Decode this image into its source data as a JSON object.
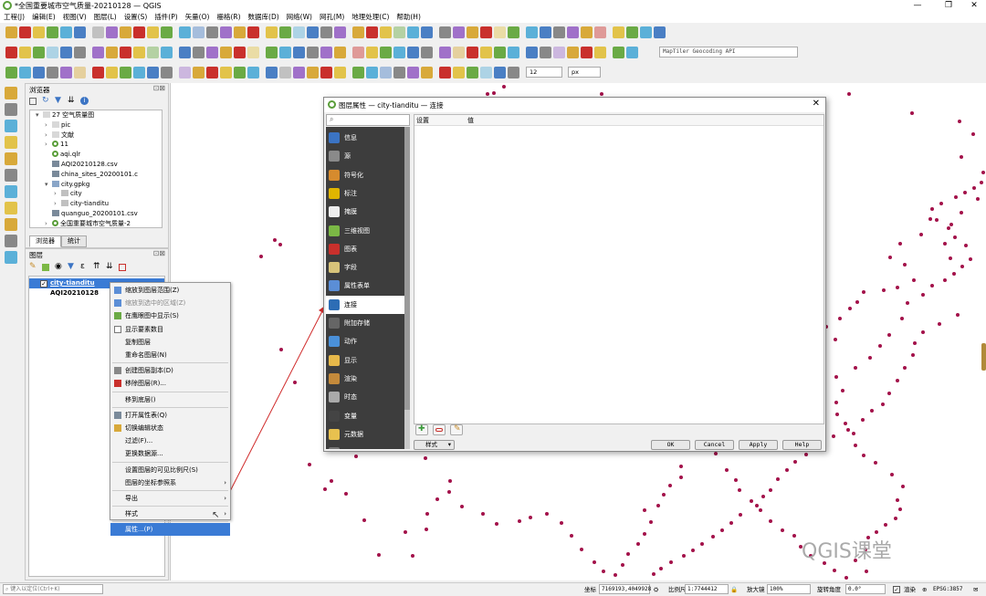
{
  "window": {
    "title": "*全国重要城市空气质量-20210128 — QGIS",
    "controls": [
      "—",
      "❐",
      "✕"
    ]
  },
  "menu": [
    "工程(J)",
    "编辑(E)",
    "视图(V)",
    "图层(L)",
    "设置(S)",
    "插件(P)",
    "矢量(O)",
    "栅格(R)",
    "数据库(D)",
    "网络(W)",
    "网孔(M)",
    "地理处理(C)",
    "帮助(H)"
  ],
  "toolbar": {
    "geocoding_input": "MapTiler Geocoding API",
    "font_size": "12",
    "font_unit": "px"
  },
  "browser": {
    "title": "浏览器",
    "tree": [
      {
        "label": "27 空气质量图",
        "arrow": "▾",
        "indent": 36,
        "icon": "folder"
      },
      {
        "label": "pic",
        "arrow": "›",
        "indent": 46,
        "icon": "folder"
      },
      {
        "label": "文献",
        "arrow": "›",
        "indent": 46,
        "icon": "folder"
      },
      {
        "label": "11",
        "arrow": "›",
        "indent": 46,
        "icon": "qgis"
      },
      {
        "label": "aqi.qlr",
        "arrow": "",
        "indent": 46,
        "icon": "qgis"
      },
      {
        "label": "AQI20210128.csv",
        "arrow": "",
        "indent": 46,
        "icon": "table"
      },
      {
        "label": "china_sites_20200101.c",
        "arrow": "",
        "indent": 46,
        "icon": "table"
      },
      {
        "label": "city.gpkg",
        "arrow": "▾",
        "indent": 46,
        "icon": "db"
      },
      {
        "label": "city",
        "arrow": "›",
        "indent": 56,
        "icon": "pts"
      },
      {
        "label": "city-tianditu",
        "arrow": "›",
        "indent": 56,
        "icon": "pts"
      },
      {
        "label": "quanguo_20200101.csv",
        "arrow": "",
        "indent": 46,
        "icon": "table"
      },
      {
        "label": "全国重要城市空气质量-2",
        "arrow": "›",
        "indent": 46,
        "icon": "qgis"
      }
    ],
    "tabs": [
      "浏览器",
      "统计"
    ]
  },
  "layers": {
    "title": "图层",
    "items": [
      {
        "label": "city-tianditu",
        "selected": true,
        "checked": true
      },
      {
        "label": "AQI20210128",
        "selected": false,
        "checked": false
      }
    ]
  },
  "context_menu": {
    "items": [
      {
        "label": "缩放到图层范围(Z)",
        "state": "normal",
        "icon": "zoom"
      },
      {
        "label": "缩放到选中的区域(Z)",
        "state": "disabled",
        "icon": "zoom"
      },
      {
        "label": "在鹰眼图中显示(S)",
        "state": "normal",
        "icon": "eye"
      },
      {
        "label": "显示要素数目",
        "state": "normal",
        "icon": "box"
      },
      {
        "label": "复制图层",
        "state": "normal",
        "icon": ""
      },
      {
        "label": "重命名图层(N)",
        "state": "normal",
        "icon": ""
      },
      {
        "label": "创建图层副本(D)",
        "state": "normal",
        "icon": "dup",
        "sep_before": true
      },
      {
        "label": "移除图层(R)...",
        "state": "normal",
        "icon": "remove"
      },
      {
        "label": "移到底层()",
        "state": "normal",
        "icon": "",
        "sep_before": true
      },
      {
        "label": "打开属性表(Q)",
        "state": "normal",
        "icon": "table",
        "sep_before": true
      },
      {
        "label": "切换编辑状态",
        "state": "normal",
        "icon": "pencil"
      },
      {
        "label": "过滤(F)...",
        "state": "normal",
        "icon": ""
      },
      {
        "label": "更换数据源...",
        "state": "normal",
        "icon": ""
      },
      {
        "label": "设置图层的可见比例尺(S)",
        "state": "normal",
        "icon": "",
        "sep_before": true
      },
      {
        "label": "图层的坐标参照系",
        "state": "normal",
        "icon": "",
        "submenu": true
      },
      {
        "label": "导出",
        "state": "normal",
        "icon": "",
        "submenu": true,
        "sep_before": true
      },
      {
        "label": "样式",
        "state": "normal",
        "icon": "",
        "submenu": true,
        "sep_before": true
      },
      {
        "label": "属性...(P)",
        "state": "highlighted",
        "icon": "",
        "sep_before": true
      }
    ]
  },
  "dialog": {
    "title": "图层属性 — city-tianditu — 连接",
    "search_placeholder": "",
    "sections": [
      {
        "label": "信息",
        "color": "#3b74c4"
      },
      {
        "label": "源",
        "color": "#8a8a8a"
      },
      {
        "label": "符号化",
        "color": "#d68b2e"
      },
      {
        "label": "标注",
        "color": "#e0b500"
      },
      {
        "label": "掩膜",
        "color": "#eeeeee"
      },
      {
        "label": "三维视图",
        "color": "#7bb845"
      },
      {
        "label": "图表",
        "color": "#c9302c"
      },
      {
        "label": "字段",
        "color": "#d7c37a"
      },
      {
        "label": "属性表单",
        "color": "#5b8ed6"
      },
      {
        "label": "连接",
        "color": "#2d6db5",
        "active": true
      },
      {
        "label": "附加存储",
        "color": "#666666"
      },
      {
        "label": "动作",
        "color": "#4a90d9"
      },
      {
        "label": "显示",
        "color": "#e6b84a"
      },
      {
        "label": "渲染",
        "color": "#c48a3b"
      },
      {
        "label": "时态",
        "color": "#aaaaaa"
      },
      {
        "label": "变量",
        "color": "#444444"
      },
      {
        "label": "元数据",
        "color": "#e8c14f"
      },
      {
        "label": "相关性",
        "color": "#777777"
      }
    ],
    "table_headers": [
      "设置",
      "值"
    ],
    "style_button": "样式",
    "buttons": [
      "OK",
      "Cancel",
      "Apply",
      "Help"
    ]
  },
  "statusbar": {
    "locator_placeholder": "键入以定位(Ctrl+K)",
    "coord_label": "坐标",
    "coord_value": "7169193,4049928",
    "scale_label": "比例尺",
    "scale_value": "1:7744412",
    "magnifier_label": "放大镜",
    "magnifier_value": "100%",
    "rotation_label": "旋转角度",
    "rotation_value": "0.0°",
    "render_label": "渲染",
    "crs": "EPSG:3857"
  },
  "watermark": "QGIS课堂",
  "colors": {
    "point": "#a3124a",
    "selection": "#3a7bd5",
    "dialog_sidebar": "#3d3d3d",
    "arrow": "#d02b2b"
  }
}
